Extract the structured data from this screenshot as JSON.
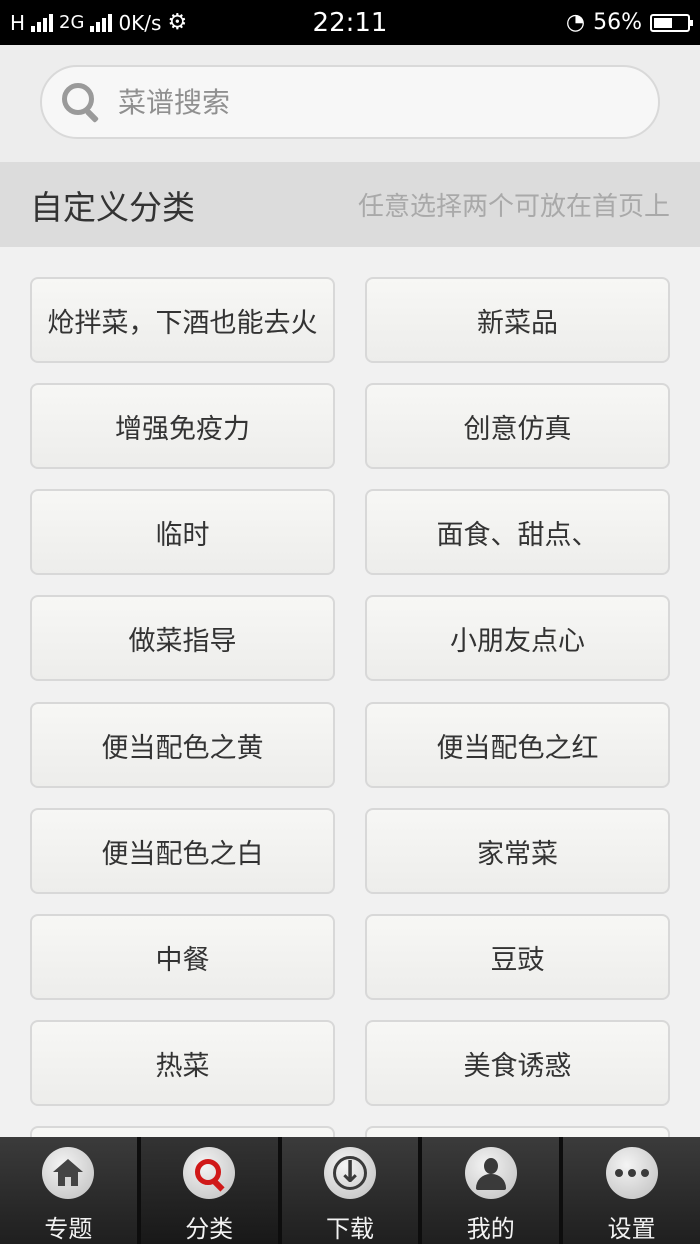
{
  "status_bar": {
    "network_h": "H",
    "network_2g": "2G",
    "speed": "0K/s",
    "time": "22:11",
    "battery": "56%",
    "battery_level": 0.56
  },
  "search": {
    "placeholder": "菜谱搜索"
  },
  "section": {
    "title": "自定义分类",
    "hint": "任意选择两个可放在首页上"
  },
  "categories": [
    "炝拌菜，下酒也能去火",
    "新菜品",
    "增强免疫力",
    "创意仿真",
    "临时",
    "面食、甜点、",
    "做菜指导",
    "小朋友点心",
    "便当配色之黄",
    "便当配色之红",
    "便当配色之白",
    "家常菜",
    "中餐",
    "豆豉",
    "热菜",
    "美食诱惑",
    "",
    ""
  ],
  "nav": [
    {
      "label": "专题",
      "icon": "home-icon"
    },
    {
      "label": "分类",
      "icon": "search-icon"
    },
    {
      "label": "下载",
      "icon": "download-icon"
    },
    {
      "label": "我的",
      "icon": "user-icon"
    },
    {
      "label": "设置",
      "icon": "more-icon"
    }
  ],
  "colors": {
    "accent": "#d01818",
    "header_bg": "#dcdcdc",
    "nav_bg": "#2a2a2a"
  }
}
